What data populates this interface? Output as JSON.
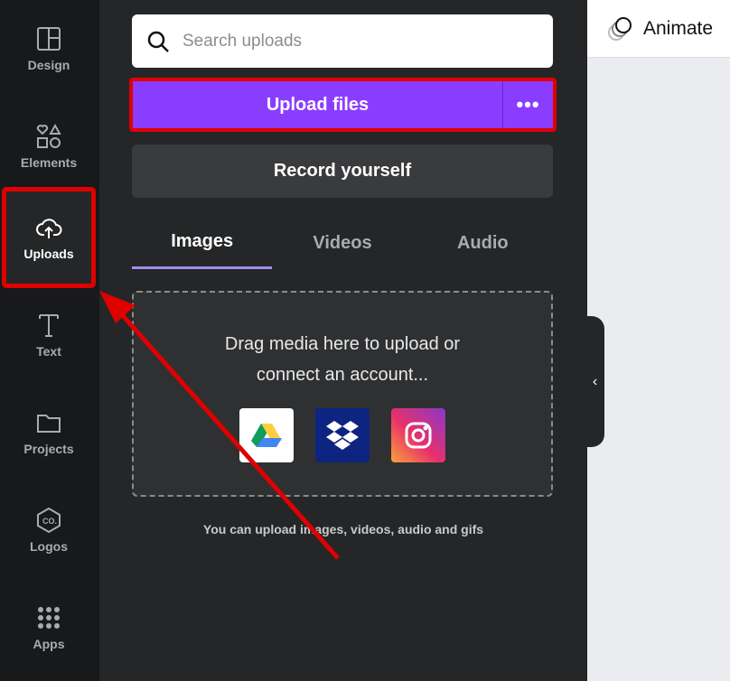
{
  "rail": [
    {
      "label": "Design",
      "icon": "layout-icon"
    },
    {
      "label": "Elements",
      "icon": "shapes-icon"
    },
    {
      "label": "Uploads",
      "icon": "cloud-upload-icon",
      "active": true
    },
    {
      "label": "Text",
      "icon": "text-icon"
    },
    {
      "label": "Projects",
      "icon": "folder-icon"
    },
    {
      "label": "Logos",
      "icon": "logo-icon"
    },
    {
      "label": "Apps",
      "icon": "apps-grid-icon"
    }
  ],
  "search": {
    "placeholder": "Search uploads"
  },
  "upload": {
    "label": "Upload files",
    "more": "•••"
  },
  "record": {
    "label": "Record yourself"
  },
  "tabs": [
    {
      "label": "Images",
      "active": true
    },
    {
      "label": "Videos"
    },
    {
      "label": "Audio"
    }
  ],
  "drop": {
    "line1": "Drag media here to upload or",
    "line2": "connect an account...",
    "services": [
      "Google Drive",
      "Dropbox",
      "Instagram"
    ]
  },
  "note": "You can upload images, videos, audio and gifs",
  "topbar": {
    "animate": "Animate"
  },
  "handle": "‹",
  "colors": {
    "accent": "#8b3dff",
    "highlight": "#e00000"
  }
}
